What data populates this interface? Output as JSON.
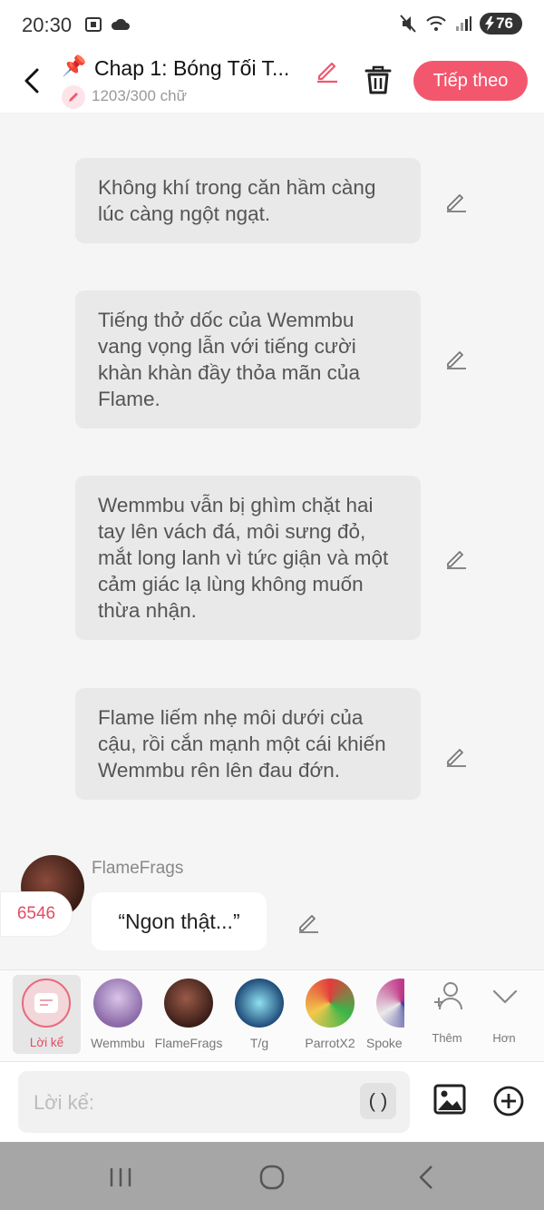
{
  "status_bar": {
    "time": "20:30",
    "battery": "76"
  },
  "header": {
    "title": "Chap 1: Bóng Tối T...",
    "word_count": "1203/300 chữ",
    "next_label": "Tiếp theo",
    "accent_color": "#f2576e"
  },
  "messages": [
    {
      "text": "Không khí trong căn hầm càng lúc càng ngột ngạt."
    },
    {
      "text": "Tiếng thở dốc của Wemmbu vang vọng lẫn với tiếng cười khàn khàn đầy thỏa mãn của Flame."
    },
    {
      "text": "Wemmbu vẫn bị ghìm chặt hai tay lên vách đá, môi sưng đỏ, mắt long lanh vì tức giận và một cảm giác lạ lùng không muốn thừa nhận."
    },
    {
      "text": "Flame liếm nhẹ môi dưới của cậu, rồi cắn mạnh một cái khiến Wemmbu rên lên đau đớn."
    }
  ],
  "dialogue": {
    "character": "FlameFrags",
    "count_badge": "6546",
    "text": "“Ngon thật...”"
  },
  "character_bar": {
    "narration_label": "Lời kể",
    "characters": [
      {
        "name": "Wemmbu"
      },
      {
        "name": "FlameFrags"
      },
      {
        "name": "T/g"
      },
      {
        "name": "ParrotX2"
      },
      {
        "name": "Spoke"
      }
    ],
    "add_label": "Thêm",
    "more_label": "Hơn"
  },
  "input": {
    "placeholder": "Lời kể:",
    "paren_label": "( )"
  }
}
